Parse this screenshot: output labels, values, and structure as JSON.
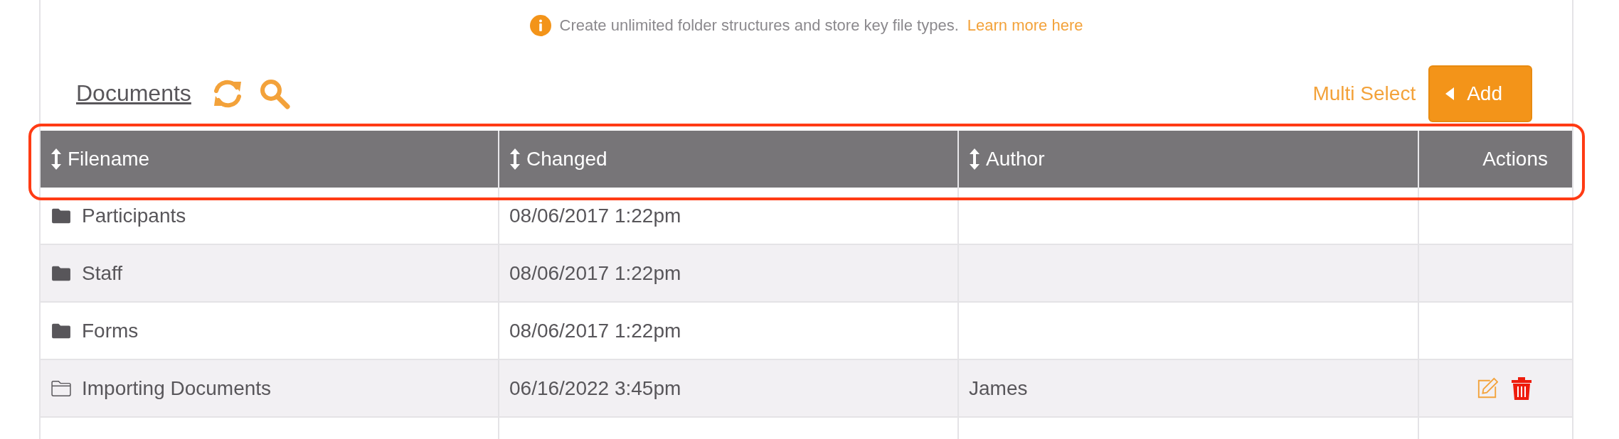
{
  "notice": {
    "text": "Create unlimited folder structures and store key file types.",
    "link": "Learn more here"
  },
  "toolbar": {
    "title": "Documents",
    "multi_select": "Multi Select",
    "add_button": "Add"
  },
  "table": {
    "highlighted": true,
    "columns": [
      {
        "label": "Filename",
        "sortable": true
      },
      {
        "label": "Changed",
        "sortable": true
      },
      {
        "label": "Author",
        "sortable": true
      },
      {
        "label": "Actions",
        "sortable": false
      }
    ],
    "rows": [
      {
        "kind": "folder",
        "filename": "Participants",
        "changed": "08/06/2017 1:22pm",
        "author": "",
        "editable": false,
        "deletable": false
      },
      {
        "kind": "folder",
        "filename": "Staff",
        "changed": "08/06/2017 1:22pm",
        "author": "",
        "editable": false,
        "deletable": false
      },
      {
        "kind": "folder",
        "filename": "Forms",
        "changed": "08/06/2017 1:22pm",
        "author": "",
        "editable": false,
        "deletable": false
      },
      {
        "kind": "folder-outline",
        "filename": "Importing Documents",
        "changed": "06/16/2022 3:45pm",
        "author": "James",
        "editable": true,
        "deletable": true
      }
    ]
  }
}
